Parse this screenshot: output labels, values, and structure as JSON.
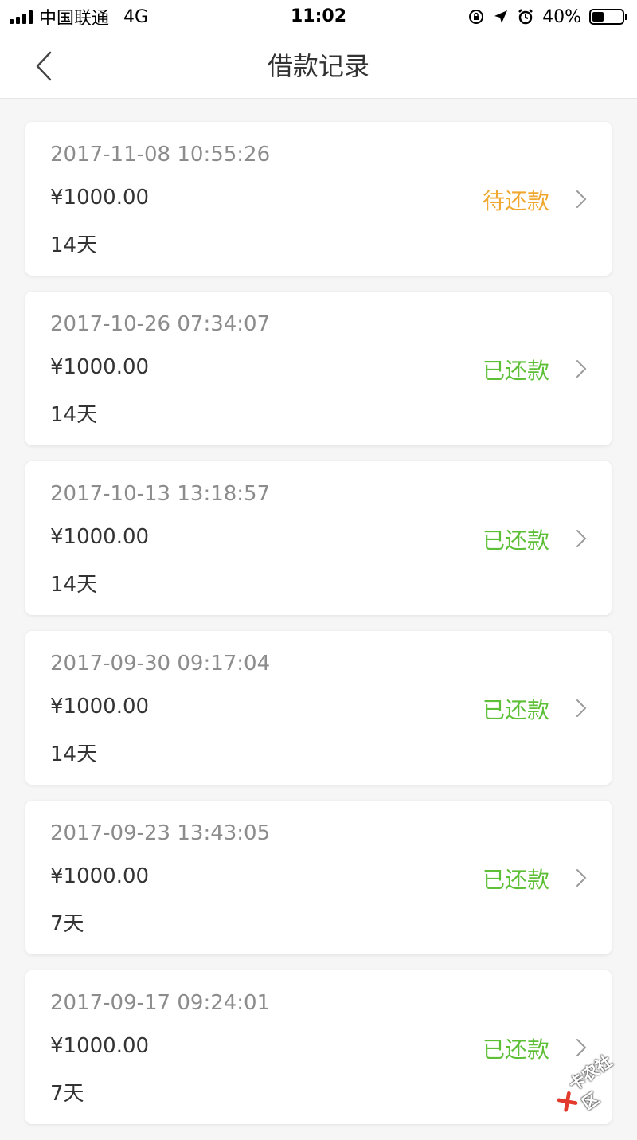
{
  "status_bar": {
    "carrier": "中国联通",
    "network": "4G",
    "time": "11:02",
    "battery": "40%",
    "battery_level": 0.4
  },
  "nav": {
    "title": "借款记录",
    "back_icon": "chevron-left-icon"
  },
  "colors": {
    "pending": "#f0a830",
    "repaid": "#5cbf35"
  },
  "records": [
    {
      "date": "2017-11-08 10:55:26",
      "amount": "¥1000.00",
      "term": "14天",
      "status": "待还款",
      "status_type": "pending"
    },
    {
      "date": "2017-10-26 07:34:07",
      "amount": "¥1000.00",
      "term": "14天",
      "status": "已还款",
      "status_type": "repaid"
    },
    {
      "date": "2017-10-13 13:18:57",
      "amount": "¥1000.00",
      "term": "14天",
      "status": "已还款",
      "status_type": "repaid"
    },
    {
      "date": "2017-09-30 09:17:04",
      "amount": "¥1000.00",
      "term": "14天",
      "status": "已还款",
      "status_type": "repaid"
    },
    {
      "date": "2017-09-23 13:43:05",
      "amount": "¥1000.00",
      "term": "7天",
      "status": "已还款",
      "status_type": "repaid"
    },
    {
      "date": "2017-09-17 09:24:01",
      "amount": "¥1000.00",
      "term": "7天",
      "status": "已还款",
      "status_type": "repaid"
    }
  ],
  "watermark": {
    "text": "卡农社区"
  }
}
